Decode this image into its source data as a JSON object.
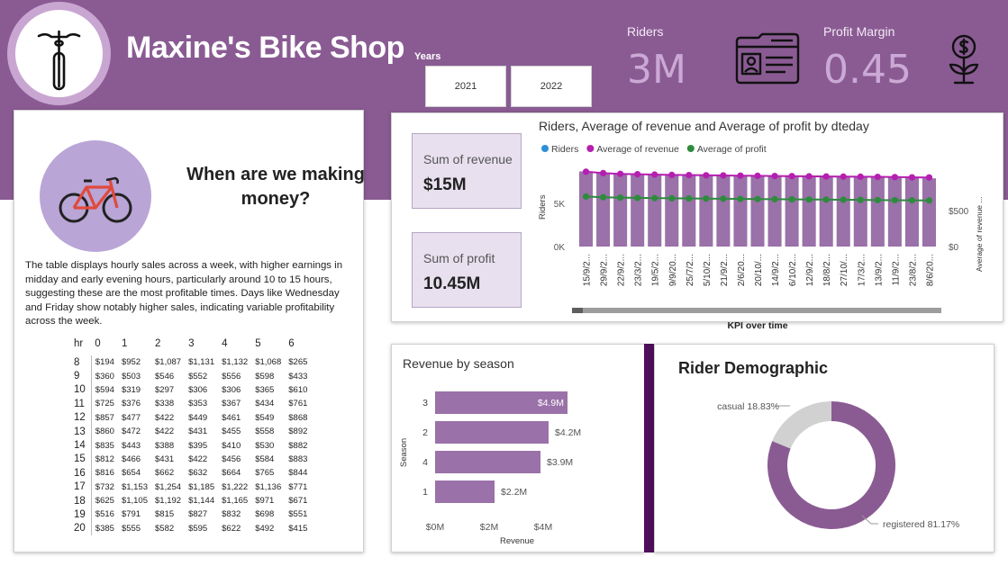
{
  "header": {
    "title": "Maxine's Bike Shop",
    "years_label": "Years",
    "years": [
      "2021",
      "2022"
    ],
    "riders_label": "Riders",
    "riders_value": "3M",
    "profit_margin_label": "Profit Margin",
    "profit_margin_value": "0.45"
  },
  "story": {
    "title": "When are we making money?",
    "body": "The table displays hourly sales across a week, with higher earnings in midday and early evening hours, particularly around 10 to 15 hours, suggesting these are the most profitable times. Days like Wednesday and Friday show notably higher sales, indicating variable profitability across the week.",
    "table": {
      "corner": "hr",
      "columns": [
        "0",
        "1",
        "2",
        "3",
        "4",
        "5",
        "6"
      ],
      "rows": [
        {
          "hr": "8",
          "v": [
            "$194",
            "$952",
            "$1,087",
            "$1,131",
            "$1,132",
            "$1,068",
            "$265"
          ]
        },
        {
          "hr": "9",
          "v": [
            "$360",
            "$503",
            "$546",
            "$552",
            "$556",
            "$598",
            "$433"
          ]
        },
        {
          "hr": "10",
          "v": [
            "$594",
            "$319",
            "$297",
            "$306",
            "$306",
            "$365",
            "$610"
          ]
        },
        {
          "hr": "11",
          "v": [
            "$725",
            "$376",
            "$338",
            "$353",
            "$367",
            "$434",
            "$761"
          ]
        },
        {
          "hr": "12",
          "v": [
            "$857",
            "$477",
            "$422",
            "$449",
            "$461",
            "$549",
            "$868"
          ]
        },
        {
          "hr": "13",
          "v": [
            "$860",
            "$472",
            "$422",
            "$431",
            "$455",
            "$558",
            "$892"
          ]
        },
        {
          "hr": "14",
          "v": [
            "$835",
            "$443",
            "$388",
            "$395",
            "$410",
            "$530",
            "$882"
          ]
        },
        {
          "hr": "15",
          "v": [
            "$812",
            "$466",
            "$431",
            "$422",
            "$456",
            "$584",
            "$883"
          ]
        },
        {
          "hr": "16",
          "v": [
            "$816",
            "$654",
            "$662",
            "$632",
            "$664",
            "$765",
            "$844"
          ]
        },
        {
          "hr": "17",
          "v": [
            "$732",
            "$1,153",
            "$1,254",
            "$1,185",
            "$1,222",
            "$1,136",
            "$771"
          ]
        },
        {
          "hr": "18",
          "v": [
            "$625",
            "$1,105",
            "$1,192",
            "$1,144",
            "$1,165",
            "$971",
            "$671"
          ]
        },
        {
          "hr": "19",
          "v": [
            "$516",
            "$791",
            "$815",
            "$827",
            "$832",
            "$698",
            "$551"
          ]
        },
        {
          "hr": "20",
          "v": [
            "$385",
            "$555",
            "$582",
            "$595",
            "$622",
            "$492",
            "$415"
          ]
        }
      ]
    }
  },
  "kpis": {
    "revenue_label": "Sum of revenue",
    "revenue_value": "$15M",
    "profit_label": "Sum of profit",
    "profit_value": "10.45M"
  },
  "colors": {
    "banner": "#8a5b93",
    "bar": "#9a71a8",
    "riders_dot": "#2d8fd6",
    "revenue_line": "#b51fb0",
    "profit_line": "#2e8b3e",
    "donut_registered": "#8a5b93",
    "donut_casual": "#d1d1d1"
  },
  "chart_data": [
    {
      "type": "bar",
      "title": "Riders, Average of revenue and Average of profit by dteday",
      "legend": [
        "Riders",
        "Average of revenue",
        "Average of profit"
      ],
      "legend_position": "top-left",
      "xlabel": "KPI over time",
      "ylabel": "Riders",
      "ylabel_right": "Average of revenue ...",
      "yticks": [
        "0K",
        "5K"
      ],
      "yticks_right": [
        "$0",
        "$500"
      ],
      "ylim": [
        0,
        10000
      ],
      "ylim_right": [
        0,
        1200
      ],
      "categories": [
        "15/9/2...",
        "29/9/2...",
        "22/9/2...",
        "23/3/2...",
        "19/5/2...",
        "9/9/20...",
        "25/7/2...",
        "5/10/2...",
        "21/9/2...",
        "2/6/20...",
        "20/10/...",
        "14/9/2...",
        "6/10/2...",
        "12/9/2...",
        "18/8/2...",
        "27/10/...",
        "17/3/2...",
        "13/9/2...",
        "11/9/2...",
        "23/8/2...",
        "8/6/20..."
      ],
      "series": [
        {
          "name": "Riders",
          "axis": "left",
          "values": [
            8700,
            8550,
            8400,
            8400,
            8350,
            8300,
            8300,
            8250,
            8250,
            8200,
            8200,
            8150,
            8150,
            8100,
            8100,
            8050,
            8050,
            8000,
            8000,
            7950,
            7900
          ]
        },
        {
          "name": "Average of revenue",
          "axis": "right",
          "values": [
            1040,
            1020,
            1010,
            1005,
            1000,
            995,
            993,
            990,
            988,
            985,
            983,
            980,
            978,
            976,
            974,
            972,
            970,
            968,
            965,
            962,
            960
          ]
        },
        {
          "name": "Average of profit",
          "axis": "right",
          "values": [
            695,
            685,
            680,
            676,
            673,
            670,
            668,
            666,
            664,
            662,
            660,
            658,
            656,
            654,
            652,
            650,
            648,
            646,
            644,
            642,
            640
          ]
        }
      ]
    },
    {
      "type": "bar",
      "orientation": "horizontal",
      "title": "Revenue by season",
      "xlabel": "Revenue",
      "ylabel": "Season",
      "categories": [
        "3",
        "2",
        "4",
        "1"
      ],
      "values": [
        4.9,
        4.2,
        3.9,
        2.2
      ],
      "value_labels": [
        "$4.9M",
        "$4.2M",
        "$3.9M",
        "$2.2M"
      ],
      "xticks": [
        "$0M",
        "$2M",
        "$4M"
      ],
      "xlim": [
        0,
        5
      ]
    },
    {
      "type": "pie",
      "title": "Rider Demographic",
      "labels": [
        "registered",
        "casual"
      ],
      "values": [
        81.17,
        18.83
      ],
      "value_labels": [
        "registered 81.17%",
        "casual 18.83%"
      ]
    }
  ]
}
